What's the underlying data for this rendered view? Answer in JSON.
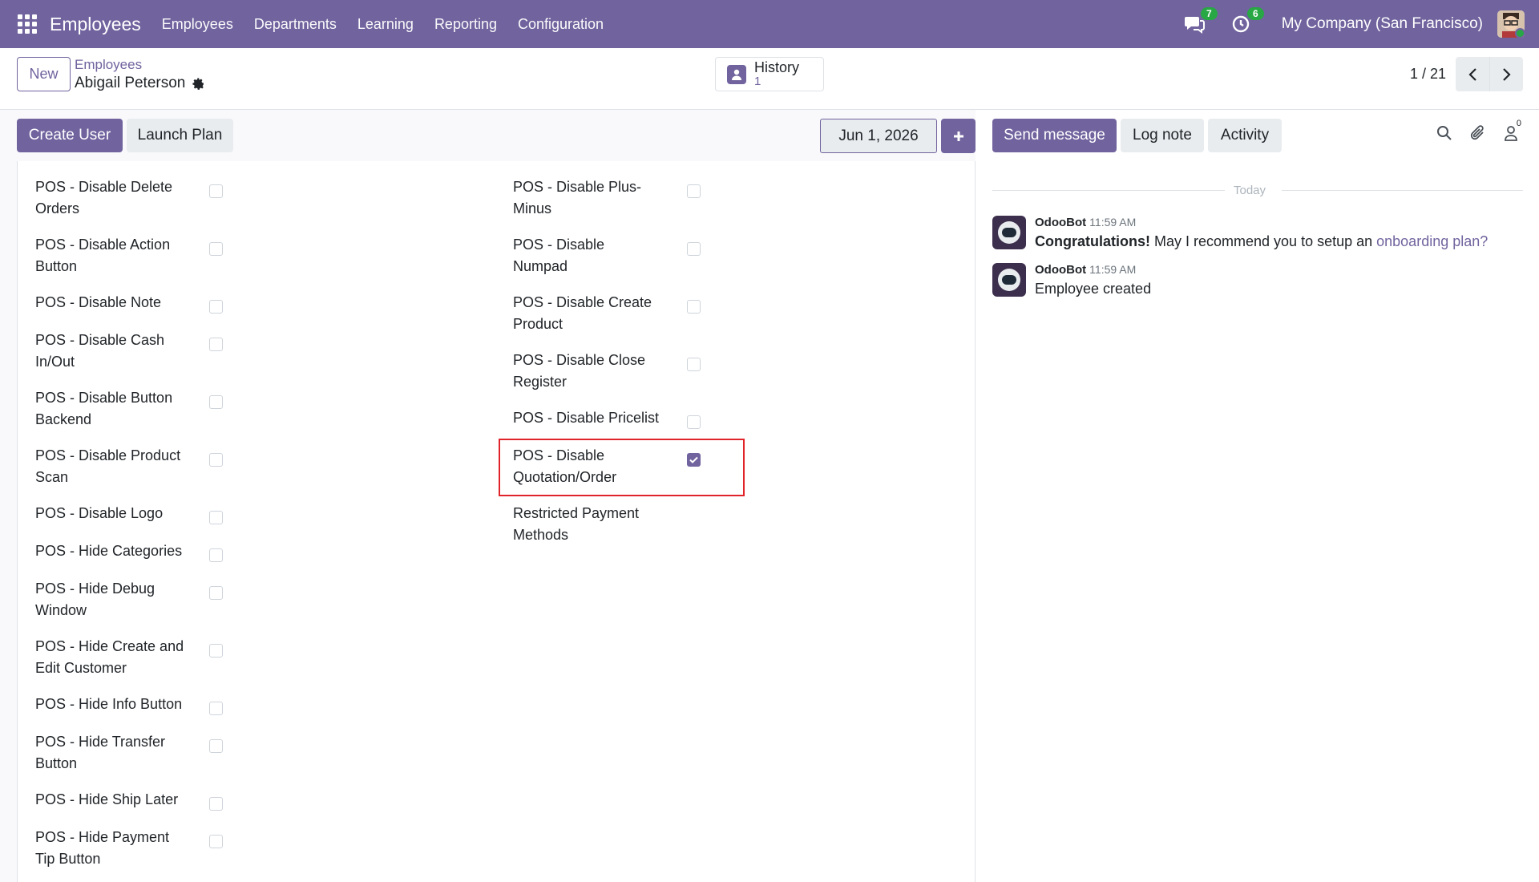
{
  "navbar": {
    "brand": "Employees",
    "menu": [
      "Employees",
      "Departments",
      "Learning",
      "Reporting",
      "Configuration"
    ],
    "messages_badge": "7",
    "activities_badge": "6",
    "company": "My Company (San Francisco)"
  },
  "control": {
    "new_label": "New",
    "breadcrumb_parent": "Employees",
    "breadcrumb_current": "Abigail Peterson",
    "history_label": "History",
    "history_count": "1",
    "pager": "1 / 21"
  },
  "statusbar": {
    "create_user": "Create User",
    "launch_plan": "Launch Plan",
    "date": "Jun 1, 2026"
  },
  "fields_left": [
    {
      "label_lines": [
        "POS - Disable Delete",
        "Orders"
      ],
      "checked": false
    },
    {
      "label_lines": [
        "POS - Disable Action",
        "Button"
      ],
      "checked": false
    },
    {
      "label_lines": [
        "POS - Disable Note"
      ],
      "checked": false
    },
    {
      "label_lines": [
        "POS - Disable Cash",
        "In/Out"
      ],
      "checked": false
    },
    {
      "label_lines": [
        "POS - Disable Button",
        "Backend"
      ],
      "checked": false
    },
    {
      "label_lines": [
        "POS - Disable Product",
        "Scan"
      ],
      "checked": false
    },
    {
      "label_lines": [
        "POS - Disable Logo"
      ],
      "checked": false
    },
    {
      "label_lines": [
        "POS - Hide Categories"
      ],
      "checked": false
    },
    {
      "label_lines": [
        "POS - Hide Debug",
        "Window"
      ],
      "checked": false
    },
    {
      "label_lines": [
        "POS - Hide Create and",
        "Edit Customer"
      ],
      "checked": false
    },
    {
      "label_lines": [
        "POS - Hide Info Button"
      ],
      "checked": false
    },
    {
      "label_lines": [
        "POS - Hide Transfer",
        "Button"
      ],
      "checked": false
    },
    {
      "label_lines": [
        "POS - Hide Ship Later"
      ],
      "checked": false
    },
    {
      "label_lines": [
        "POS - Hide Payment",
        "Tip Button"
      ],
      "checked": false
    }
  ],
  "fields_right": [
    {
      "label_lines": [
        "POS - Disable Plus-",
        "Minus"
      ],
      "checked": false
    },
    {
      "label_lines": [
        "POS - Disable",
        "Numpad"
      ],
      "checked": false
    },
    {
      "label_lines": [
        "POS - Disable Create",
        "Product"
      ],
      "checked": false
    },
    {
      "label_lines": [
        "POS - Disable Close",
        "Register"
      ],
      "checked": false
    },
    {
      "label_lines": [
        "POS - Disable Pricelist"
      ],
      "checked": false
    },
    {
      "label_lines": [
        "POS - Disable",
        "Quotation/Order"
      ],
      "checked": true
    },
    {
      "label_lines": [
        "Restricted Payment",
        "Methods"
      ],
      "checked": null
    }
  ],
  "chatter": {
    "send_message": "Send message",
    "log_note": "Log note",
    "activity": "Activity",
    "followers_count": "0",
    "date_separator": "Today",
    "messages": [
      {
        "author": "OdooBot",
        "time": "11:59 AM",
        "bold": "Congratulations!",
        "text": " May I recommend you to setup an ",
        "link": "onboarding plan?"
      },
      {
        "author": "OdooBot",
        "time": "11:59 AM",
        "bold": "",
        "text": "Employee created",
        "link": ""
      }
    ]
  },
  "colors": {
    "primary": "#71639e",
    "highlight": "#e0242a",
    "badge": "#28a745"
  }
}
